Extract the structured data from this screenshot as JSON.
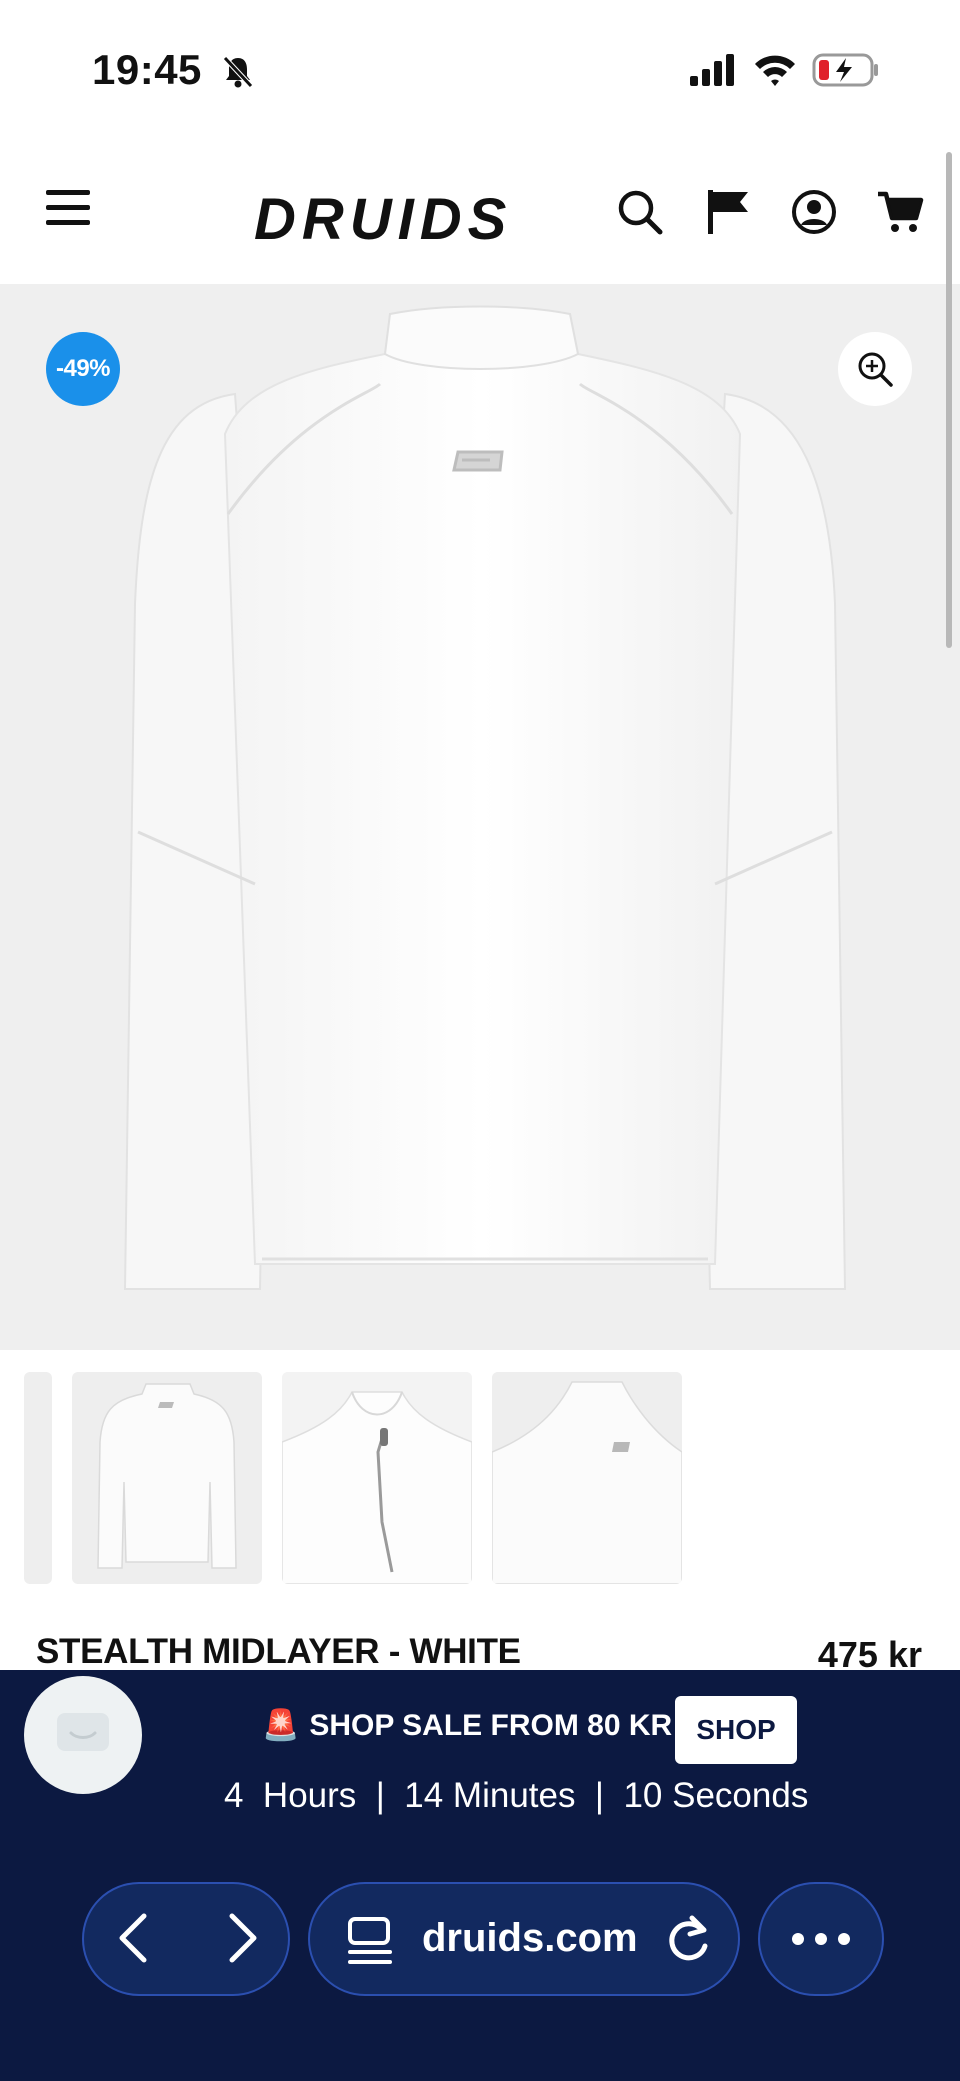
{
  "status_bar": {
    "time": "19:45"
  },
  "header": {
    "logo": "DRUIDS"
  },
  "product": {
    "discount_badge": "-49%",
    "title": "STEALTH MIDLAYER - WHITE",
    "price": "475 kr"
  },
  "promo": {
    "siren_emoji": "🚨",
    "text": "SHOP SALE FROM 80 KR",
    "button_label": "SHOP",
    "countdown": "4  Hours  |  14 Minutes  |  10 Seconds"
  },
  "browser": {
    "domain": "druids.com"
  },
  "colors": {
    "discount_badge": "#1a90ea",
    "promo_background": "#0c1941",
    "toolbar_pill": "#12295f",
    "toolbar_border": "#2b4fb0"
  }
}
